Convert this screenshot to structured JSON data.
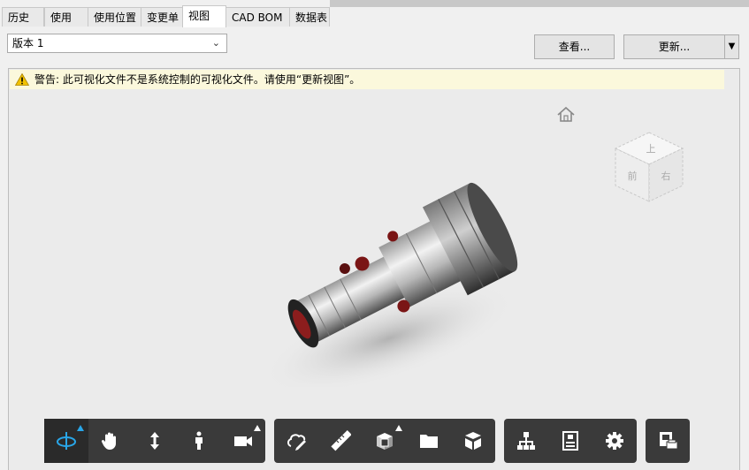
{
  "tabs": [
    {
      "label": "历史"
    },
    {
      "label": "使用"
    },
    {
      "label": "使用位置"
    },
    {
      "label": "变更单"
    },
    {
      "label": "视图"
    },
    {
      "label": "CAD BOM"
    },
    {
      "label": "数据表"
    }
  ],
  "active_tab": "视图",
  "version_select": {
    "value": "版本 1"
  },
  "buttons": {
    "view": "查看...",
    "update": "更新..."
  },
  "warning": {
    "text": "警告: 此可视化文件不是系统控制的可视化文件。请使用“更新视图”。"
  },
  "view_cube": {
    "top": "上",
    "front": "前",
    "right": "右"
  },
  "toolbar": {
    "active_tool": "orbit-icon",
    "groups": [
      [
        "orbit-icon",
        "pan-icon",
        "zoom-icon",
        "walk-icon",
        "camera-icon"
      ],
      [
        "markup-icon",
        "measure-icon",
        "section-box-icon",
        "folder-icon",
        "explode-icon"
      ],
      [
        "model-tree-icon",
        "properties-icon",
        "settings-icon"
      ],
      [
        "print-icon"
      ]
    ]
  },
  "colors": {
    "accent": "#29a6e8",
    "toolbar_bg": "#3a3a3a",
    "warning_bg": "#fbf8dc"
  }
}
